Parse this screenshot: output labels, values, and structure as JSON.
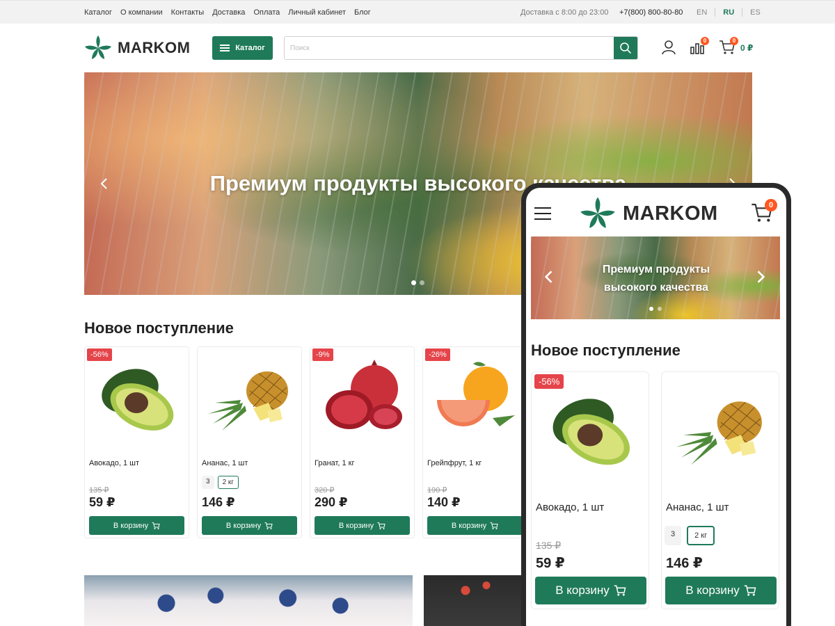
{
  "topbar": {
    "nav": [
      "Каталог",
      "О компании",
      "Контакты",
      "Доставка",
      "Оплата",
      "Личный кабинет",
      "Блог"
    ],
    "delivery": "Доставка с 8:00 до 23:00",
    "phone": "+7(800) 800-80-80",
    "languages": [
      "EN",
      "RU",
      "ES"
    ],
    "active_language": "RU"
  },
  "header": {
    "logo": "MARKOM",
    "catalog_label": "Каталог",
    "search_placeholder": "Поиск",
    "compare_count": "0",
    "cart_count": "0",
    "cart_sum": "0 ₽"
  },
  "hero": {
    "title": "Премиум продукты высокого качества",
    "slides": 2,
    "active_slide": 0
  },
  "new_arrivals": {
    "title": "Новое поступление",
    "buy_label": "В корзину",
    "products": [
      {
        "name": "Авокадо, 1 шт",
        "discount": "-56%",
        "old_price": "135 ₽",
        "price": "59 ₽",
        "options": []
      },
      {
        "name": "Ананас, 1 шт",
        "discount": "",
        "old_price": "",
        "price": "146 ₽",
        "options": [
          "3",
          "2 кг"
        ],
        "selected_option": "2 кг"
      },
      {
        "name": "Гранат, 1 кг",
        "discount": "-9%",
        "old_price": "320 ₽",
        "price": "290 ₽",
        "options": []
      },
      {
        "name": "Грейпфрут, 1 кг",
        "discount": "-26%",
        "old_price": "190 ₽",
        "price": "140 ₽",
        "options": []
      }
    ]
  },
  "mobile": {
    "logo": "MARKOM",
    "cart_count": "0",
    "hero_title": "Премиум продукты высокого качества",
    "section_title": "Новое поступление",
    "buy_label": "В корзину",
    "products": [
      {
        "name": "Авокадо, 1 шт",
        "discount": "-56%",
        "old_price": "135 ₽",
        "price": "59 ₽"
      },
      {
        "name": "Ананас, 1 шт",
        "discount": "",
        "old_price": "",
        "price": "146 ₽",
        "options": [
          "3",
          "2 кг"
        ]
      }
    ]
  },
  "colors": {
    "brand_green": "#1f7a5a",
    "badge_orange": "#ff5722",
    "discount_red": "#e5444a"
  }
}
